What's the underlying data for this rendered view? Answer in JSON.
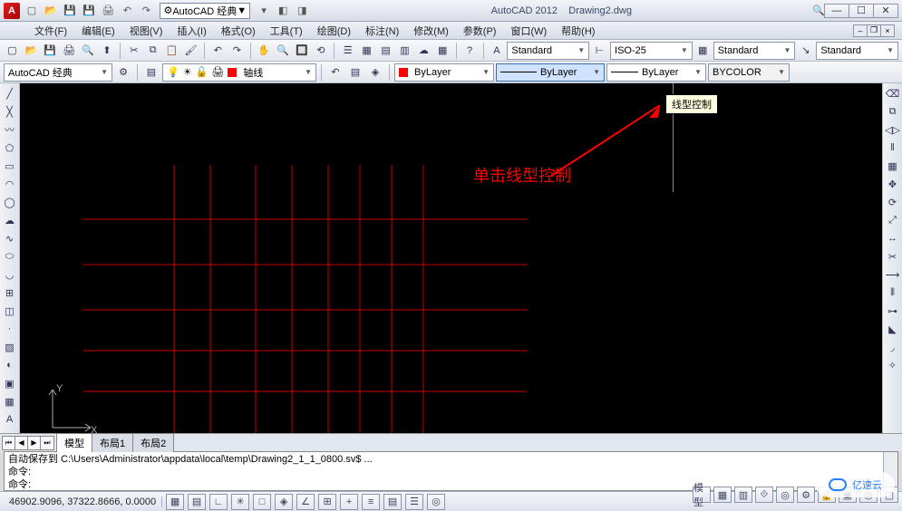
{
  "title": {
    "app": "AutoCAD 2012",
    "doc": "Drawing2.dwg"
  },
  "qat": {
    "workspace": "AutoCAD 经典"
  },
  "menu": {
    "items": [
      "文件(F)",
      "编辑(E)",
      "视图(V)",
      "插入(I)",
      "格式(O)",
      "工具(T)",
      "绘图(D)",
      "标注(N)",
      "修改(M)",
      "参数(P)",
      "窗口(W)",
      "帮助(H)"
    ]
  },
  "tb1": {
    "style1": "Standard",
    "style2": "ISO-25",
    "style3": "Standard",
    "style4": "Standard"
  },
  "tb2": {
    "workspace": "AutoCAD 经典",
    "layer": "轴线",
    "color": "ByLayer",
    "linetype": "ByLayer",
    "lineweight": "ByLayer",
    "plotstyle": "BYCOLOR"
  },
  "tooltip": "线型控制",
  "annotation": "单击线型控制",
  "tabs": {
    "items": [
      "模型",
      "布局1",
      "布局2"
    ]
  },
  "cmd": {
    "line1": "自动保存到 C:\\Users\\Administrator\\appdata\\local\\temp\\Drawing2_1_1_0800.sv$ ...",
    "line2": "命令:",
    "prompt": "命令:"
  },
  "status": {
    "coords": "46902.9096, 37322.8666, 0.0000",
    "right_label": "模型"
  },
  "watermark": "亿速云"
}
